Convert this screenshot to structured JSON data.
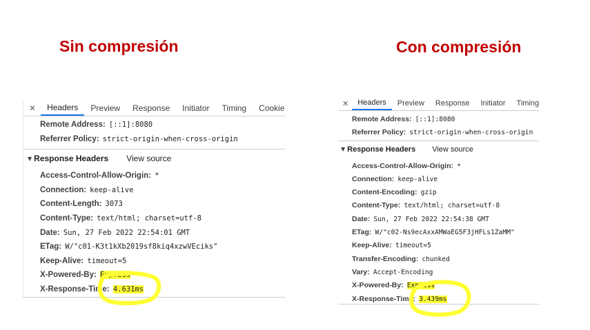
{
  "titles": {
    "left": "Sin compresión",
    "right": "Con compresión"
  },
  "colors": {
    "title": "#c00000",
    "highlight": "#ffff33",
    "tab_active": "#1a73e8"
  },
  "left": {
    "tabs": [
      "Headers",
      "Preview",
      "Response",
      "Initiator",
      "Timing",
      "Cookies"
    ],
    "general": [
      {
        "name": "Remote Address:",
        "value": "[::1]:8080"
      },
      {
        "name": "Referrer Policy:",
        "value": "strict-origin-when-cross-origin"
      }
    ],
    "section_title": "Response Headers",
    "view_source": "View source",
    "headers": [
      {
        "name": "Access-Control-Allow-Origin:",
        "value": "*"
      },
      {
        "name": "Connection:",
        "value": "keep-alive"
      },
      {
        "name": "Content-Length:",
        "value": "3073"
      },
      {
        "name": "Content-Type:",
        "value": "text/html; charset=utf-8"
      },
      {
        "name": "Date:",
        "value": "Sun, 27 Feb 2022 22:54:01 GMT"
      },
      {
        "name": "ETag:",
        "value": "W/\"c01-K3t1kXb2019sf8kiq4xzwVEciks\""
      },
      {
        "name": "Keep-Alive:",
        "value": "timeout=5"
      },
      {
        "name": "X-Powered-By:",
        "value": "Express"
      },
      {
        "name": "X-Response-Time:",
        "value": "4.631ms"
      }
    ]
  },
  "right": {
    "tabs": [
      "Headers",
      "Preview",
      "Response",
      "Initiator",
      "Timing"
    ],
    "general": [
      {
        "name": "Remote Address:",
        "value": "[::1]:8080"
      },
      {
        "name": "Referrer Policy:",
        "value": "strict-origin-when-cross-origin"
      }
    ],
    "section_title": "Response Headers",
    "view_source": "View source",
    "headers": [
      {
        "name": "Access-Control-Allow-Origin:",
        "value": "*"
      },
      {
        "name": "Connection:",
        "value": "keep-alive"
      },
      {
        "name": "Content-Encoding:",
        "value": "gzip"
      },
      {
        "name": "Content-Type:",
        "value": "text/html; charset=utf-8"
      },
      {
        "name": "Date:",
        "value": "Sun, 27 Feb 2022 22:54:38 GMT"
      },
      {
        "name": "ETag:",
        "value": "W/\"c02-Ns9ecAxxAMWaEG5F3jHFLs1ZaMM\""
      },
      {
        "name": "Keep-Alive:",
        "value": "timeout=5"
      },
      {
        "name": "Transfer-Encoding:",
        "value": "chunked"
      },
      {
        "name": "Vary:",
        "value": "Accept-Encoding"
      },
      {
        "name": "X-Powered-By:",
        "value": "Express"
      },
      {
        "name": "X-Response-Time:",
        "value": "3.439ms"
      }
    ]
  }
}
